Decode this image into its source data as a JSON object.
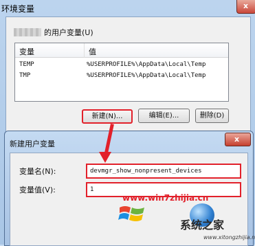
{
  "window": {
    "title": "环境变量",
    "close_glyph": "x"
  },
  "user_vars": {
    "label": "的用户变量(U)"
  },
  "list": {
    "columns": [
      "变量",
      "值"
    ],
    "rows": [
      {
        "name": "TEMP",
        "value": "%USERPROFILE%\\AppData\\Local\\Temp"
      },
      {
        "name": "TMP",
        "value": "%USERPROFILE%\\AppData\\Local\\Temp"
      }
    ]
  },
  "buttons": {
    "new": "新建(N)...",
    "edit": "编辑(E)...",
    "delete": "删除(D)"
  },
  "dialog": {
    "title": "新建用户变量",
    "close_glyph": "x",
    "name_label": "变量名(N):",
    "value_label": "变量值(V):",
    "name_value": "devmgr_show_nonpresent_devices",
    "value_value": "1"
  },
  "watermark": {
    "url": "www.win7zhijia.cn",
    "site": "系统之家",
    "domain": "www.xitongzhijia.net"
  },
  "colors": {
    "highlight": "#e2202a"
  }
}
